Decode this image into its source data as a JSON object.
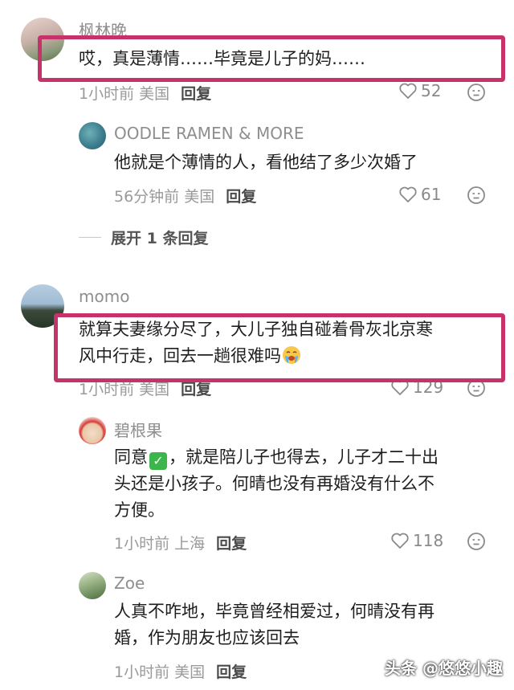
{
  "comments": [
    {
      "username": "枫林晚",
      "text": "哎，真是薄情……毕竟是儿子的妈……",
      "time": "1小时前",
      "location": "美国",
      "reply_label": "回复",
      "likes": "52"
    },
    {
      "username": "OODLE RAMEN & MORE",
      "text": "他就是个薄情的人，看他结了多少次婚了",
      "time": "56分钟前",
      "location": "美国",
      "reply_label": "回复",
      "likes": "61"
    },
    {
      "username": "momo",
      "text_line1": "就算夫妻缘分尽了，大儿子独自碰着骨灰北京寒",
      "text_line2": "风中行走，回去一趟很难吗",
      "time": "1小时前",
      "location": "美国",
      "reply_label": "回复",
      "likes": "129"
    },
    {
      "username": "碧根果",
      "text_part1": "同意",
      "text_part2": "，就是陪儿子也得去，儿子才二十出",
      "text_line2": "头还是小孩子。何晴也没有再婚没有什么不",
      "text_line3": "方便。",
      "time": "1小时前",
      "location": "上海",
      "reply_label": "回复",
      "likes": "118"
    },
    {
      "username": "Zoe",
      "text_line1": "人真不咋地，毕竟曾经相爱过，何晴没有再",
      "text_line2": "婚，作为朋友也应该回去",
      "time": "1小时前",
      "location": "美国",
      "reply_label": "回复"
    }
  ],
  "expand_replies": "展开 1 条回复",
  "watermark": "头条 @悠悠小趣",
  "colors": {
    "highlight": "#c5336a",
    "check": "#3cb54a"
  }
}
